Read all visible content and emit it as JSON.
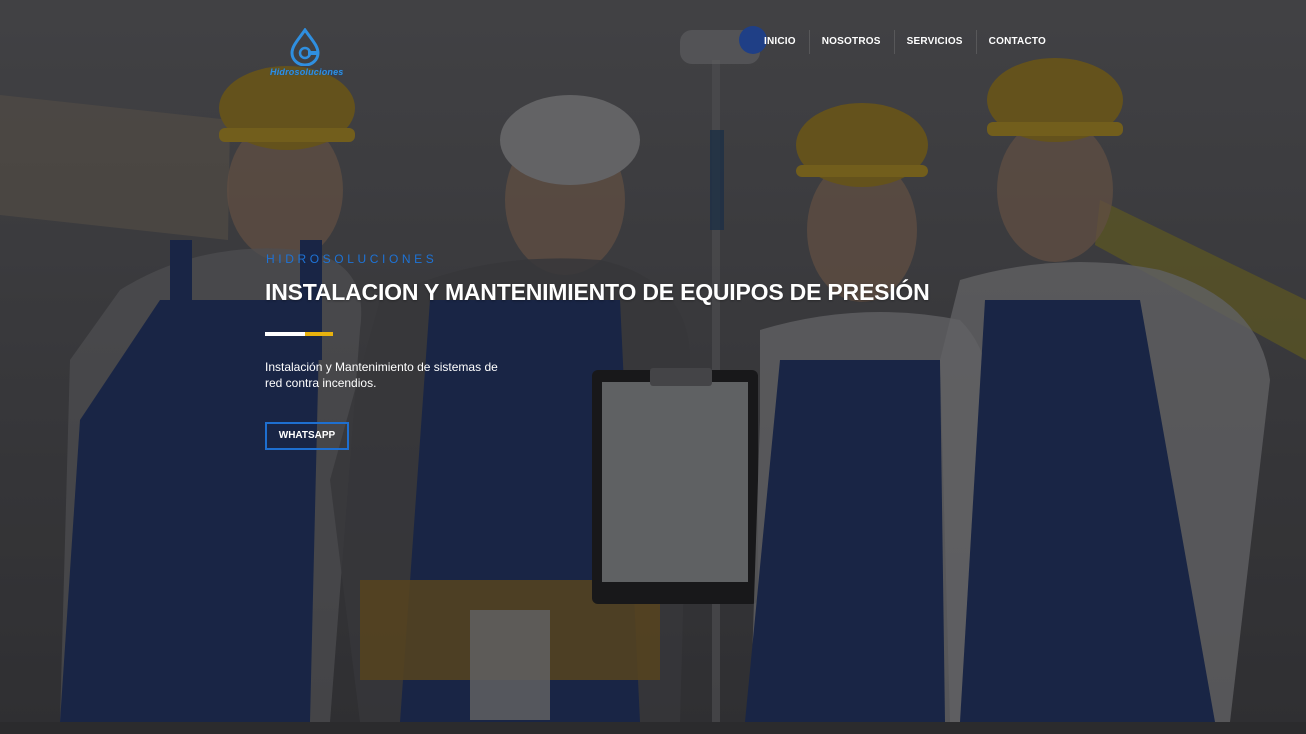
{
  "brand": {
    "logo_text": "Hidrosoluciones",
    "accent_color": "#1e73d6",
    "highlight_color": "#e8b20e"
  },
  "nav": {
    "items": [
      {
        "label": "INICIO",
        "active": true
      },
      {
        "label": "NOSOTROS",
        "active": false
      },
      {
        "label": "SERVICIOS",
        "active": false
      },
      {
        "label": "CONTACTO",
        "active": false
      }
    ]
  },
  "hero": {
    "eyebrow": "HIDROSOLUCIONES",
    "headline": "INSTALACION Y MANTENIMIENTO DE EQUIPOS DE PRESIÓN",
    "description": "Instalación y Mantenimiento de sistemas de red contra incendios.",
    "cta_label": "WHATSAPP",
    "background_image": "four-workers-hardhats-overalls-photo"
  }
}
